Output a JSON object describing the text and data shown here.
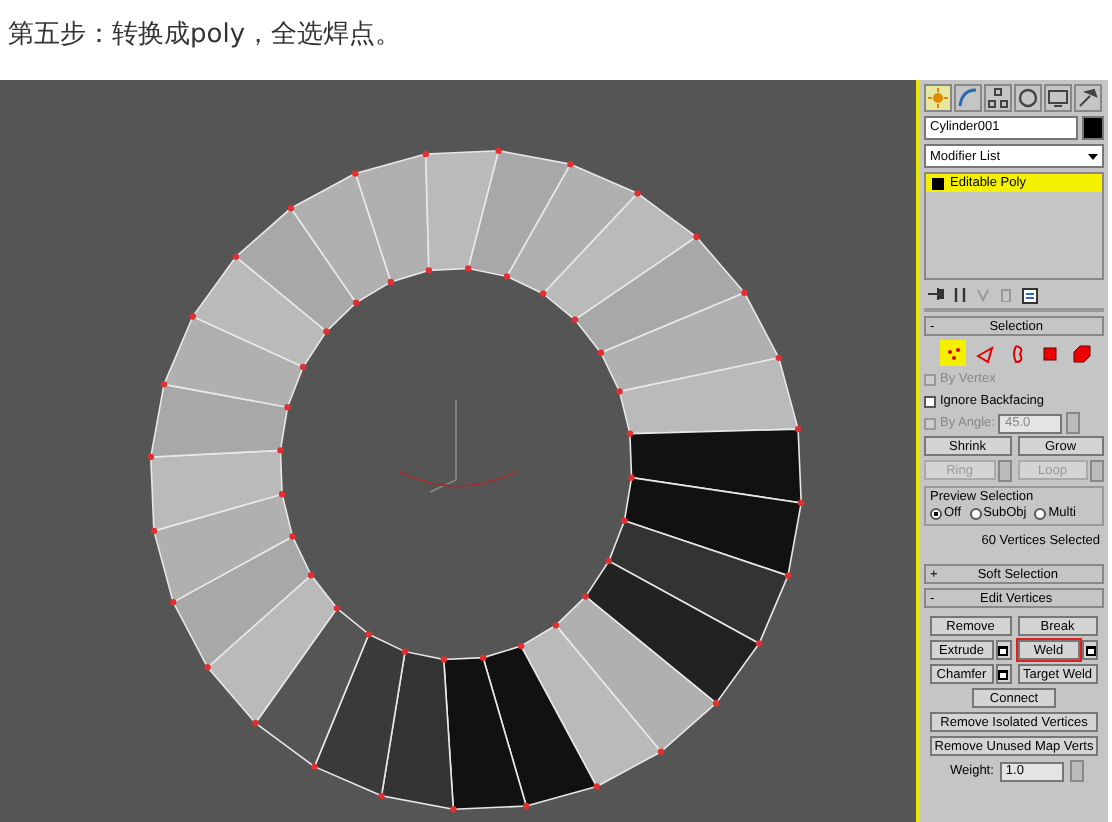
{
  "heading": "第五步：转换成poly，全选焊点。",
  "command_tabs": [
    {
      "kind": "sun",
      "selected": true
    },
    {
      "kind": "arc",
      "selected": false
    },
    {
      "kind": "hierarchy",
      "selected": false
    },
    {
      "kind": "circle",
      "selected": false
    },
    {
      "kind": "monitor",
      "selected": false
    },
    {
      "kind": "hammer",
      "selected": false
    }
  ],
  "object_name": "Cylinder001",
  "modifier_list": "Modifier List",
  "modifier_stack": [
    {
      "label": "Editable Poly",
      "selected": true
    }
  ],
  "selection_rollout": {
    "sign": "-",
    "title": "Selection",
    "subobject_levels": [
      {
        "kind": "vertex",
        "selected": true
      },
      {
        "kind": "edge",
        "selected": false
      },
      {
        "kind": "border",
        "selected": false
      },
      {
        "kind": "polygon",
        "selected": false
      },
      {
        "kind": "element",
        "selected": false
      }
    ],
    "checks": [
      {
        "label": "By Vertex",
        "checked": false,
        "disabled": true
      },
      {
        "label": "Ignore Backfacing",
        "checked": false,
        "disabled": false
      }
    ],
    "by_angle": {
      "label": "By Angle:",
      "checked": false,
      "disabled": true,
      "value": "45.0"
    },
    "buttons": [
      {
        "label": "Shrink",
        "disabled": false,
        "spinner": false
      },
      {
        "label": "Grow",
        "disabled": false,
        "spinner": false
      },
      {
        "label": "Ring",
        "disabled": true,
        "spinner": true
      },
      {
        "label": "Loop",
        "disabled": true,
        "spinner": true
      }
    ],
    "preview_selection": {
      "title": "Preview Selection",
      "options": [
        {
          "label": "Off",
          "selected": true
        },
        {
          "label": "SubObj",
          "selected": false
        },
        {
          "label": "Multi",
          "selected": false
        }
      ]
    },
    "status": "60 Vertices Selected"
  },
  "soft_selection_rollout": {
    "sign": "+",
    "title": "Soft Selection"
  },
  "edit_vertices_rollout": {
    "sign": "-",
    "title": "Edit Vertices",
    "button_rows": [
      [
        {
          "label": "Remove",
          "settings": false,
          "highlighted": false
        },
        {
          "label": "Break",
          "settings": false,
          "highlighted": false
        }
      ],
      [
        {
          "label": "Extrude",
          "settings": true,
          "highlighted": false
        },
        {
          "label": "Weld",
          "settings": true,
          "highlighted": true
        }
      ],
      [
        {
          "label": "Chamfer",
          "settings": true,
          "highlighted": false
        },
        {
          "label": "Target Weld",
          "settings": false,
          "highlighted": false
        }
      ],
      [
        {
          "label": "Connect",
          "settings": false,
          "highlighted": false
        }
      ],
      [
        {
          "label": "Remove Isolated Vertices",
          "settings": false,
          "highlighted": false
        }
      ],
      [
        {
          "label": "Remove Unused Map Verts",
          "settings": false,
          "highlighted": false
        }
      ]
    ],
    "weight": {
      "label": "Weight:",
      "value": "1.0"
    }
  }
}
